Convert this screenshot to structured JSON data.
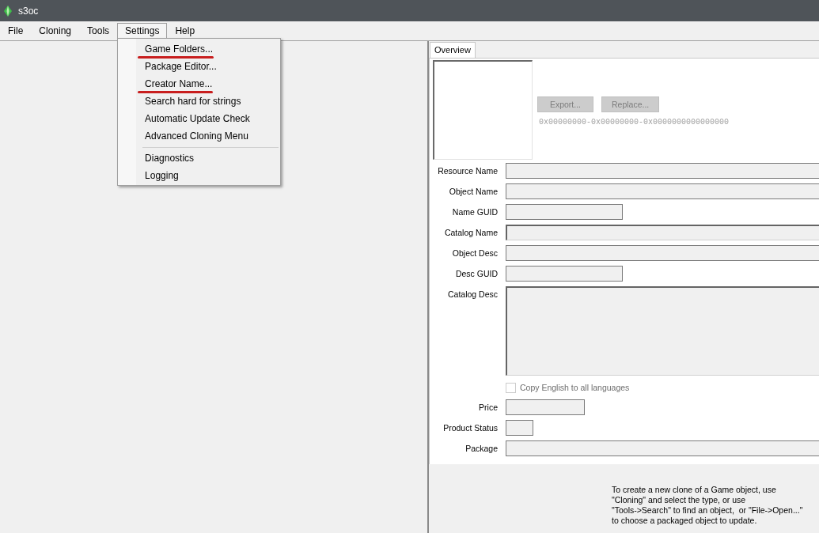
{
  "window": {
    "title": "s3oc"
  },
  "menu_bar": [
    {
      "label": "File",
      "selected": false
    },
    {
      "label": "Cloning",
      "selected": false
    },
    {
      "label": "Tools",
      "selected": false
    },
    {
      "label": "Settings",
      "selected": true
    },
    {
      "label": "Help",
      "selected": false
    }
  ],
  "settings_menu": [
    {
      "kind": "item",
      "label": "Game Folders...",
      "underlined": true
    },
    {
      "kind": "item",
      "label": "Package Editor...",
      "underlined": false
    },
    {
      "kind": "item",
      "label": "Creator Name...",
      "underlined": true
    },
    {
      "kind": "item",
      "label": "Search hard for strings",
      "underlined": false
    },
    {
      "kind": "item",
      "label": "Automatic Update Check",
      "underlined": false
    },
    {
      "kind": "item",
      "label": "Advanced Cloning Menu",
      "underlined": false
    },
    {
      "kind": "separator"
    },
    {
      "kind": "item",
      "label": "Diagnostics",
      "underlined": false
    },
    {
      "kind": "item",
      "label": "Logging",
      "underlined": false
    }
  ],
  "tabs": [
    {
      "label": "Overview",
      "selected": true
    }
  ],
  "overview": {
    "buttons": [
      {
        "label": "Export...",
        "disabled": true
      },
      {
        "label": "Replace...",
        "disabled": true
      }
    ],
    "resource_key": "0x00000000-0x00000000-0x0000000000000000",
    "fields": [
      {
        "kind": "text",
        "label": "Resource Name",
        "disabled": true
      },
      {
        "kind": "text",
        "label": "Object Name",
        "disabled": true
      },
      {
        "kind": "guid",
        "label": "Name GUID",
        "disabled": true
      },
      {
        "kind": "sunken",
        "label": "Catalog Name",
        "disabled": true
      },
      {
        "kind": "text",
        "label": "Object Desc",
        "disabled": true
      },
      {
        "kind": "guid",
        "label": "Desc GUID",
        "disabled": true
      },
      {
        "kind": "multiline",
        "label": "Catalog Desc",
        "disabled": true
      },
      {
        "kind": "checkbox",
        "label": "Copy English to all languages",
        "checked": false,
        "disabled": true
      },
      {
        "kind": "price",
        "label": "Price",
        "disabled": true
      },
      {
        "kind": "status",
        "label": "Product Status",
        "disabled": true
      },
      {
        "kind": "text",
        "label": "Package",
        "disabled": true
      }
    ]
  },
  "help_text": "To create a new clone of a Game object, use\n\"Cloning\" and select the type, or use\n\"Tools->Search\" to find an object,  or \"File->Open...\"\nto choose a packaged object to update."
}
